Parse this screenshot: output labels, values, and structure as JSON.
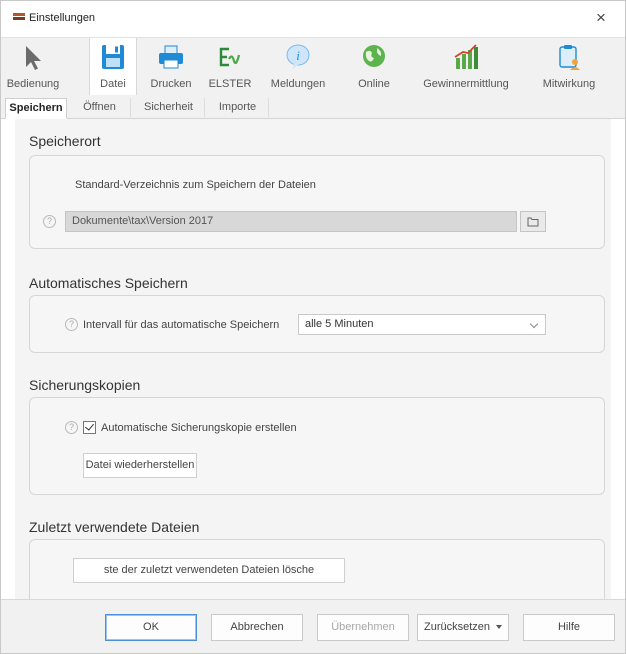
{
  "window": {
    "title": "Einstellungen",
    "close_symbol": "×"
  },
  "toolbar": {
    "items": [
      {
        "label": "Bedienung",
        "icon": "cursor-arrow-icon"
      },
      {
        "label": "Datei",
        "icon": "floppy-disk-icon"
      },
      {
        "label": "Drucken",
        "icon": "printer-icon"
      },
      {
        "label": "ELSTER",
        "icon": "elster-logo-icon"
      },
      {
        "label": "Meldungen",
        "icon": "info-balloon-icon"
      },
      {
        "label": "Online",
        "icon": "globe-icon"
      },
      {
        "label": "Gewinnermittlung",
        "icon": "bar-chart-icon"
      },
      {
        "label": "Mitwirkung",
        "icon": "clipboard-user-icon"
      }
    ],
    "active": "Datei"
  },
  "subtabs": {
    "items": [
      "Speichern",
      "Öffnen",
      "Sicherheit",
      "Importe"
    ],
    "active": "Speichern"
  },
  "sections": {
    "speicherort": {
      "title": "Speicherort",
      "description": "Standard-Verzeichnis zum Speichern der Dateien",
      "path_value": "Dokumente\\tax\\Version 2017"
    },
    "auto_save": {
      "title": "Automatisches Speichern",
      "label": "Intervall für das automatische Speichern",
      "selected": "alle 5 Minuten"
    },
    "backups": {
      "title": "Sicherungskopien",
      "checkbox_label": "Automatische Sicherungskopie erstellen",
      "checked": true,
      "restore_button": "Datei wiederherstellen"
    },
    "recent": {
      "title": "Zuletzt verwendete Dateien",
      "clear_button": "ste der zuletzt verwendeten Dateien lösche"
    }
  },
  "help_symbol": "?",
  "footer": {
    "ok": "OK",
    "cancel": "Abbrechen",
    "apply": "Übernehmen",
    "reset": "Zurücksetzen",
    "help": "Hilfe"
  },
  "colors": {
    "toolbar_bg": "#f1f1f1",
    "content_bg": "#f4f4f4",
    "primary_border": "#4a8fd8"
  }
}
